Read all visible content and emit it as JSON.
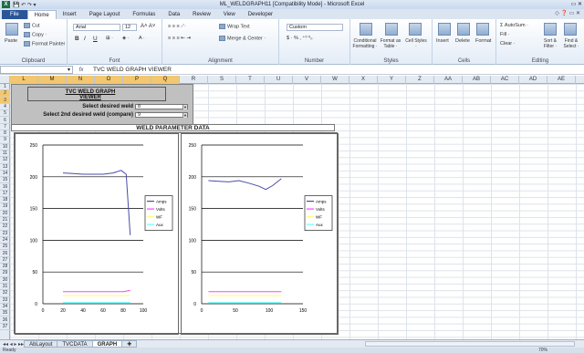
{
  "window": {
    "title": "ML_WELDGRAPH11 [Compatibility Mode] - Microsoft Excel",
    "controls": "▭ ✕"
  },
  "ribbon_tabs": [
    "File",
    "Home",
    "Insert",
    "Page Layout",
    "Formulas",
    "Data",
    "Review",
    "View",
    "Developer"
  ],
  "ribbon": {
    "clipboard": {
      "paste": "Paste",
      "cut": "Cut",
      "copy": "Copy ·",
      "painter": "Format Painter",
      "label": "Clipboard"
    },
    "font": {
      "name": "Arial",
      "size": "12",
      "label": "Font"
    },
    "alignment": {
      "wrap": "Wrap Text",
      "merge": "Merge & Center ·",
      "label": "Alignment"
    },
    "number": {
      "format": "Custom",
      "label": "Number"
    },
    "styles": {
      "cond": "Conditional Formatting ·",
      "table": "Format as Table ·",
      "cell": "Cell Styles ·",
      "label": "Styles"
    },
    "cells": {
      "insert": "Insert",
      "delete": "Delete",
      "format": "Format",
      "label": "Cells"
    },
    "editing": {
      "autosum": "Σ AutoSum ·",
      "fill": "Fill ·",
      "clear": "Clear ·",
      "sort": "Sort & Filter ·",
      "find": "Find & Select ·",
      "label": "Editing"
    }
  },
  "formula_bar": {
    "namebox": "",
    "formula": "TVC WELD GRAPH VIEWER"
  },
  "columns": [
    "L",
    "M",
    "N",
    "O",
    "P",
    "Q",
    "R",
    "S",
    "T",
    "U",
    "V",
    "W",
    "X",
    "Y",
    "Z",
    "AA",
    "AB",
    "AC",
    "AD",
    "AE"
  ],
  "selected_columns": [
    "L",
    "M",
    "N",
    "O",
    "P",
    "Q"
  ],
  "rows": [
    "1",
    "2",
    "3",
    "4",
    "5",
    "6",
    "7",
    "8",
    "9",
    "10",
    "11",
    "12",
    "13",
    "14",
    "15",
    "16",
    "17",
    "18",
    "19",
    "20",
    "21",
    "22",
    "23",
    "24",
    "25",
    "26",
    "27",
    "28",
    "29",
    "30",
    "31",
    "32",
    "33",
    "34",
    "35",
    "36",
    "37"
  ],
  "selected_rows": [
    "2",
    "3"
  ],
  "viewer": {
    "title": "TVC WELD GRAPH VIEWER",
    "sel1_label": "Select desired weld",
    "sel1_value": "8",
    "sel2_label": "Select 2nd desired weld (compare)",
    "sel2_value": "9",
    "header": "WELD PARAMETER DATA"
  },
  "chart_data": [
    {
      "type": "line",
      "ylim": [
        0,
        250
      ],
      "xlim": [
        0,
        100
      ],
      "yticks": [
        0,
        50,
        100,
        150,
        200,
        250
      ],
      "xticks": [
        0,
        20,
        40,
        60,
        80,
        100
      ],
      "grid": "horizontal",
      "legend_placement": "right",
      "series": [
        {
          "name": "Amps",
          "color": "#4b4ba8",
          "x": [
            20,
            30,
            40,
            50,
            60,
            70,
            78,
            83,
            87
          ],
          "y": [
            206,
            205,
            204,
            204,
            204,
            206,
            210,
            204,
            108
          ]
        },
        {
          "name": "Volts",
          "color": "#ff40ff",
          "x": [
            20,
            40,
            60,
            80,
            87
          ],
          "y": [
            19,
            19,
            19,
            19,
            21
          ]
        },
        {
          "name": "WF",
          "color": "#ffff66",
          "x": [
            20,
            40,
            60,
            80,
            87
          ],
          "y": [
            13,
            13,
            13,
            13,
            13
          ]
        },
        {
          "name": "Aux",
          "color": "#66ffff",
          "x": [
            20,
            40,
            60,
            80,
            87
          ],
          "y": [
            2,
            2,
            2,
            2,
            2
          ]
        }
      ]
    },
    {
      "type": "line",
      "ylim": [
        0,
        250
      ],
      "xlim": [
        0,
        150
      ],
      "yticks": [
        0,
        50,
        100,
        150,
        200,
        250
      ],
      "xticks": [
        0,
        50,
        100,
        150
      ],
      "grid": "horizontal",
      "legend_placement": "right",
      "series": [
        {
          "name": "Amps",
          "color": "#4b4ba8",
          "x": [
            10,
            25,
            40,
            55,
            70,
            85,
            95,
            105,
            118
          ],
          "y": [
            194,
            193,
            192,
            194,
            190,
            185,
            180,
            186,
            197
          ]
        },
        {
          "name": "Volts",
          "color": "#ff40ff",
          "x": [
            10,
            40,
            70,
            100,
            118
          ],
          "y": [
            19,
            19,
            19,
            19,
            19
          ]
        },
        {
          "name": "WF",
          "color": "#ffff66",
          "x": [
            10,
            40,
            70,
            100,
            118
          ],
          "y": [
            13,
            13,
            13,
            13,
            13
          ]
        },
        {
          "name": "Aux",
          "color": "#66ffff",
          "x": [
            10,
            40,
            70,
            100,
            118
          ],
          "y": [
            2,
            2,
            2,
            2,
            2
          ]
        }
      ]
    }
  ],
  "sheet_tabs": [
    "AbLayout",
    "TVCDATA",
    "GRAPH"
  ],
  "active_sheet": "GRAPH",
  "status": {
    "ready": "Ready",
    "zoom": "70%"
  }
}
